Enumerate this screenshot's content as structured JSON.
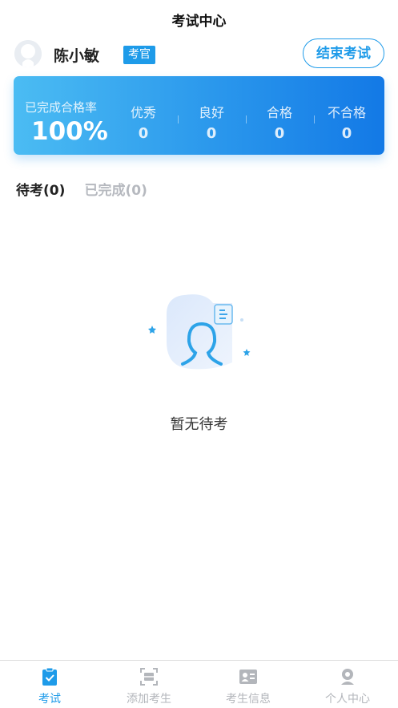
{
  "header": {
    "title": "考试中心"
  },
  "user": {
    "name": "陈小敏",
    "role": "考官",
    "end_button": "结束考试"
  },
  "stats": {
    "rate_label": "已完成合格率",
    "rate_value": "100%",
    "items": [
      {
        "label": "优秀",
        "value": "0"
      },
      {
        "label": "良好",
        "value": "0"
      },
      {
        "label": "合格",
        "value": "0"
      },
      {
        "label": "不合格",
        "value": "0"
      }
    ]
  },
  "tabs": [
    {
      "label": "待考(0)",
      "active": true
    },
    {
      "label": "已完成(0)",
      "active": false
    }
  ],
  "empty": {
    "text": "暂无待考",
    "icon": "empty-exam-illustration"
  },
  "tabbar": [
    {
      "label": "考试",
      "icon": "clipboard-check-icon",
      "active": true
    },
    {
      "label": "添加考生",
      "icon": "scan-icon",
      "active": false
    },
    {
      "label": "考生信息",
      "icon": "id-card-icon",
      "active": false
    },
    {
      "label": "个人中心",
      "icon": "person-icon",
      "active": false
    }
  ],
  "colors": {
    "accent": "#1e9be9",
    "inactive": "#b3b6bb"
  }
}
